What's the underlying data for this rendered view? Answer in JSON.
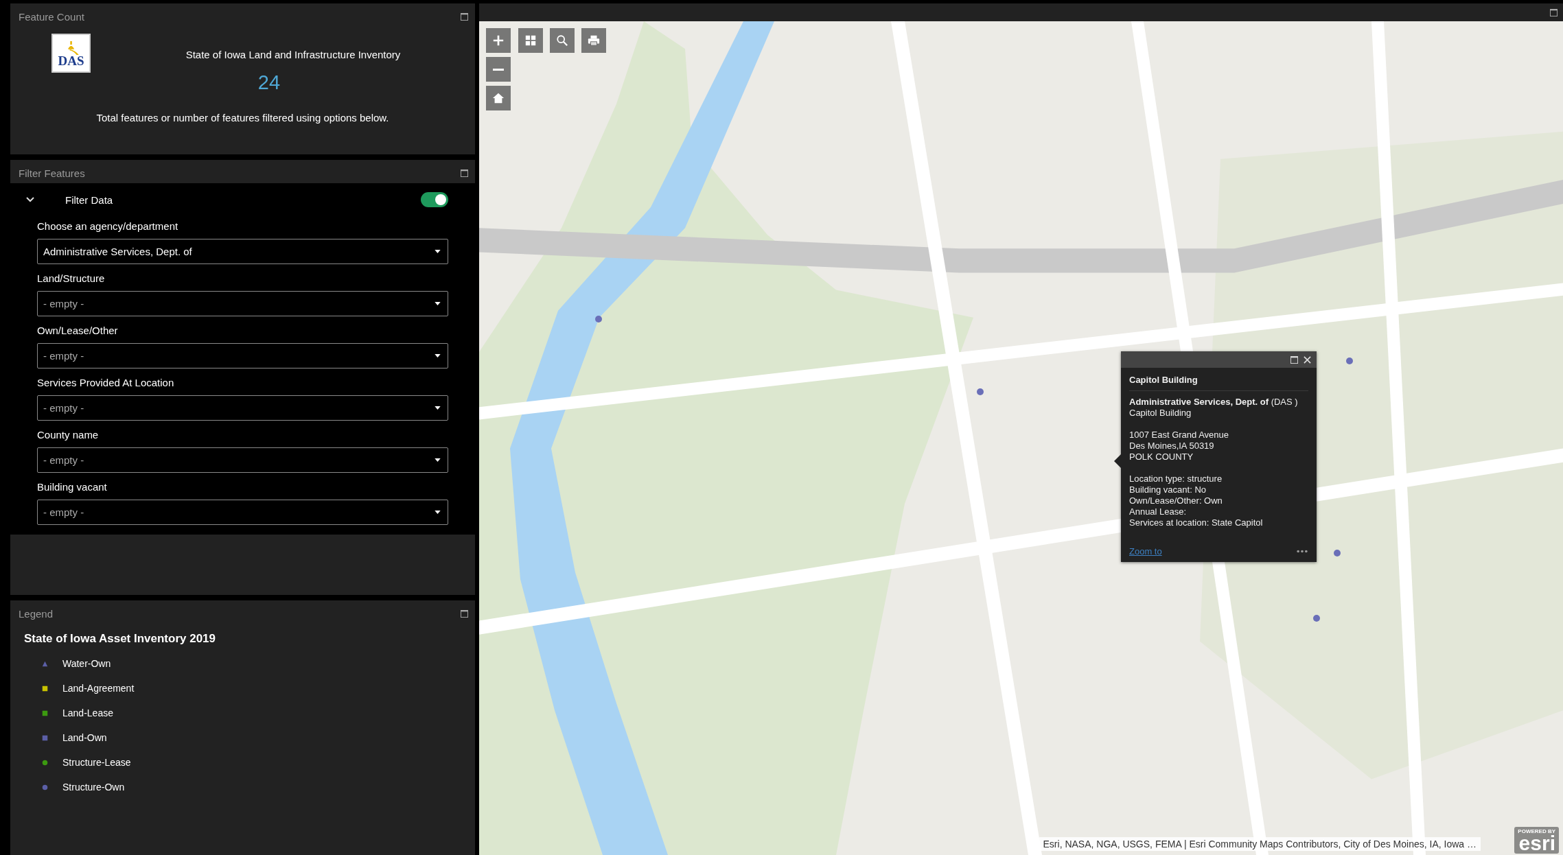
{
  "feature_count": {
    "title": "Feature Count",
    "logo_text": "DAS",
    "heading": "State of Iowa Land and Infrastructure Inventory",
    "count": "24",
    "caption": "Total features or number of features filtered using options below."
  },
  "filter_features": {
    "title": "Filter Features",
    "section": {
      "label": "Filter Data",
      "expanded": true,
      "on": true
    },
    "fields": [
      {
        "label": "Choose an agency/department",
        "value": "Administrative Services, Dept. of"
      },
      {
        "label": "Land/Structure",
        "placeholder": "- empty -"
      },
      {
        "label": "Own/Lease/Other",
        "placeholder": "- empty -"
      },
      {
        "label": "Services Provided At Location",
        "placeholder": "- empty -"
      },
      {
        "label": "County name",
        "placeholder": "- empty -"
      },
      {
        "label": "Building vacant",
        "placeholder": "- empty -"
      }
    ]
  },
  "legend": {
    "title": "Legend",
    "layer": "State of Iowa Asset Inventory 2019",
    "items": [
      {
        "label": "Water-Own",
        "kind": "triangle",
        "color": "#5b5fa6"
      },
      {
        "label": "Land-Agreement",
        "kind": "square",
        "color": "#c8c200"
      },
      {
        "label": "Land-Lease",
        "kind": "square",
        "color": "#3c9a10"
      },
      {
        "label": "Land-Own",
        "kind": "square",
        "color": "#5b5fa6"
      },
      {
        "label": "Structure-Lease",
        "kind": "circle",
        "color": "#3c9a10"
      },
      {
        "label": "Structure-Own",
        "kind": "circle",
        "color": "#5b5fa6"
      }
    ]
  },
  "map": {
    "popup": {
      "title": "Capitol Building",
      "agency": "**Administrative Services, Dept. of** (DAS )",
      "name": "Capitol Building",
      "address": [
        "1007 East Grand Avenue",
        "Des Moines,IA 50319",
        "POLK COUNTY"
      ],
      "details": [
        "Location type: structure",
        "Building vacant: No",
        "Own/Lease/Other: Own",
        "Annual Lease:",
        "Services at location: State Capitol"
      ],
      "link": "Zoom to"
    },
    "attribution": "Esri, NASA, NGA, USGS, FEMA | Esri Community Maps Contributors, City of Des Moines, IA, Iowa …",
    "logo": {
      "tagline": "POWERED BY",
      "name": "esri"
    }
  }
}
